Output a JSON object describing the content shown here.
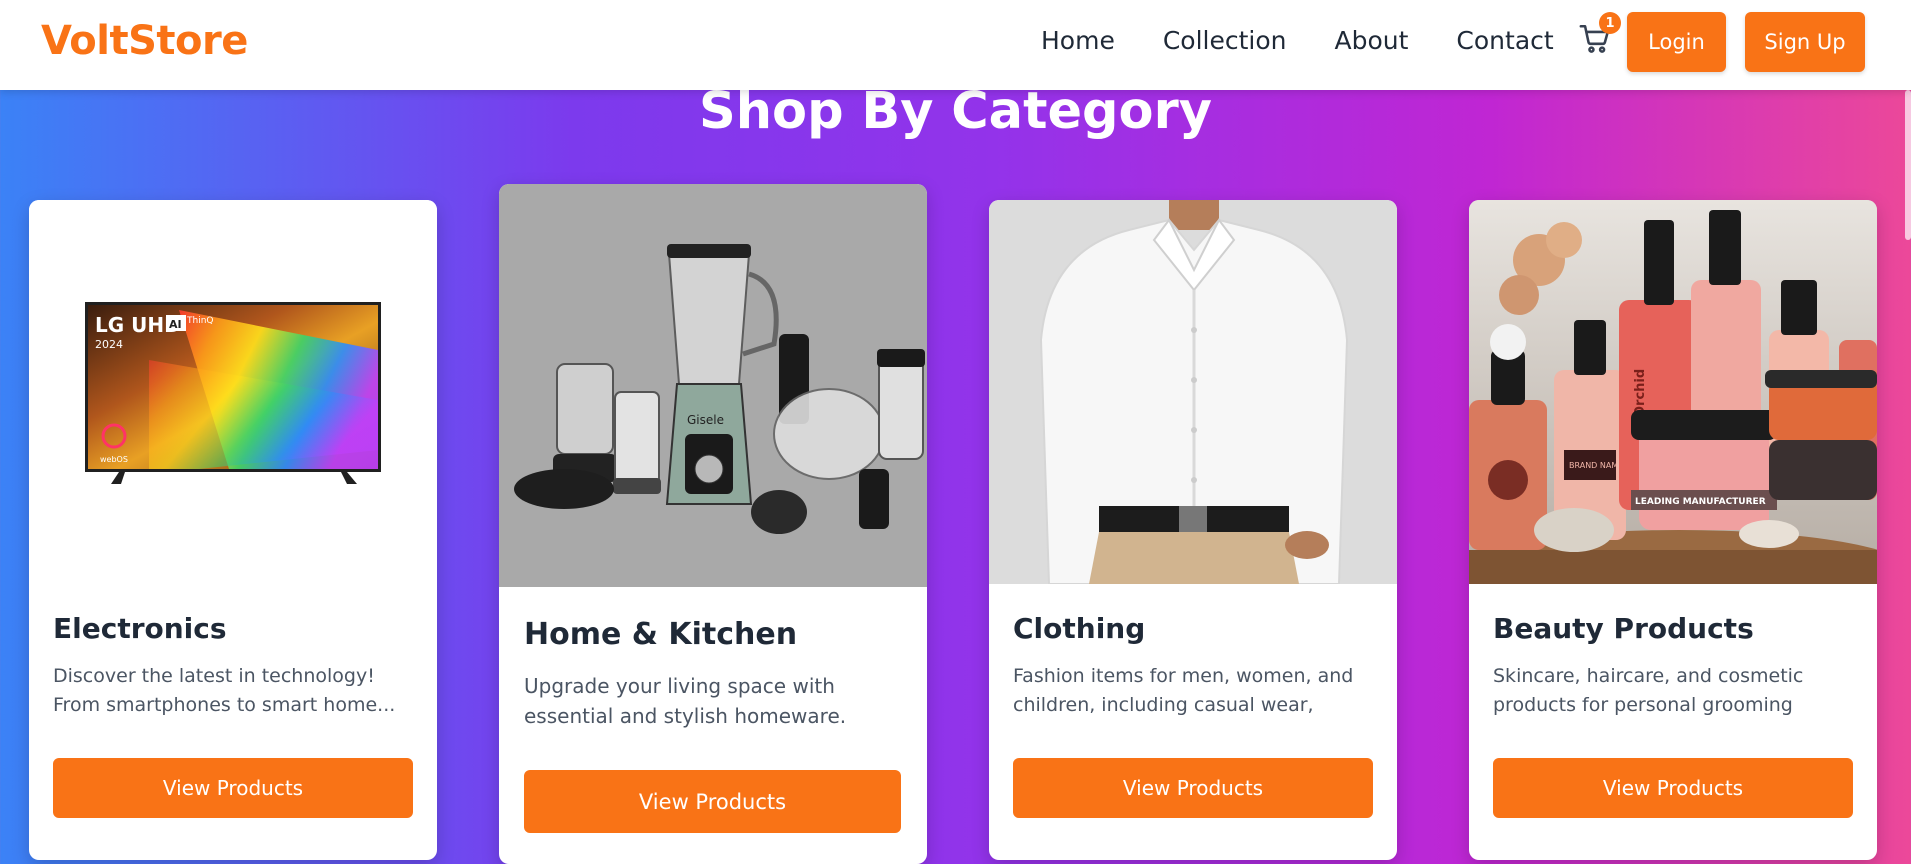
{
  "navbar": {
    "brand": "VoltStore",
    "links": [
      "Home",
      "Collection",
      "About",
      "Contact"
    ],
    "cart_count": "1",
    "login_label": "Login",
    "signup_label": "Sign Up"
  },
  "page": {
    "title": "Shop By Category"
  },
  "categories": [
    {
      "title": "Electronics",
      "description": "Discover the latest in technology! From smartphones to smart home...",
      "button": "View Products",
      "image_text": {
        "brand": "LG UHD",
        "badge": "AI",
        "sub": "ThinQ",
        "year": "2024",
        "os": "webOS"
      }
    },
    {
      "title": "Home & Kitchen",
      "description": "Upgrade your living space with essential and stylish homeware. From...",
      "button": "View Products",
      "image_text": {
        "brand": "Gisele"
      }
    },
    {
      "title": "Clothing",
      "description": "Fashion items for men, women, and children, including casual wear, form...",
      "button": "View Products"
    },
    {
      "title": "Beauty Products",
      "description": "Skincare, haircare, and cosmetic products for personal grooming and...",
      "button": "View Products",
      "image_text": {
        "brand": "Orchid",
        "brand_name": "BRAND NAME",
        "jar": "LEADING MANUFACTURER"
      }
    }
  ],
  "colors": {
    "accent": "#f97316",
    "text_dark": "#1f2937",
    "text_muted": "#4b5563"
  },
  "icons": [
    "cart-icon"
  ]
}
